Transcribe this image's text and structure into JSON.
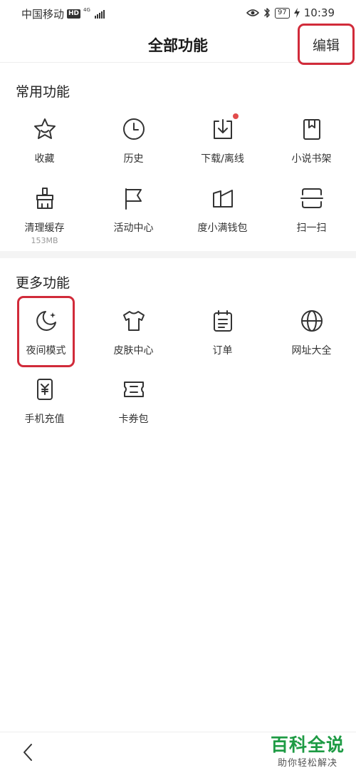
{
  "status_bar": {
    "carrier": "中国移动",
    "hd": "HD",
    "network": "4G",
    "battery": "97",
    "time": "10:39"
  },
  "header": {
    "title": "全部功能",
    "edit_label": "编辑"
  },
  "common": {
    "title": "常用功能",
    "items": [
      {
        "label": "收藏",
        "icon": "star-icon"
      },
      {
        "label": "历史",
        "icon": "clock-icon"
      },
      {
        "label": "下载/离线",
        "icon": "download-icon"
      },
      {
        "label": "小说书架",
        "icon": "bookmark-book-icon"
      },
      {
        "label": "清理缓存",
        "sublabel": "153MB",
        "icon": "broom-icon"
      },
      {
        "label": "活动中心",
        "icon": "flag-icon"
      },
      {
        "label": "度小满钱包",
        "icon": "wallet-icon"
      },
      {
        "label": "扫一扫",
        "icon": "scan-icon"
      }
    ]
  },
  "more": {
    "title": "更多功能",
    "items": [
      {
        "label": "夜间模式",
        "icon": "moon-icon"
      },
      {
        "label": "皮肤中心",
        "icon": "shirt-icon"
      },
      {
        "label": "订单",
        "icon": "order-icon"
      },
      {
        "label": "网址大全",
        "icon": "globe-icon"
      },
      {
        "label": "手机充值",
        "icon": "phone-yen-icon"
      },
      {
        "label": "卡券包",
        "icon": "ticket-icon"
      }
    ]
  },
  "watermark": {
    "title": "百科全说",
    "subtitle": "助你轻松解决"
  }
}
